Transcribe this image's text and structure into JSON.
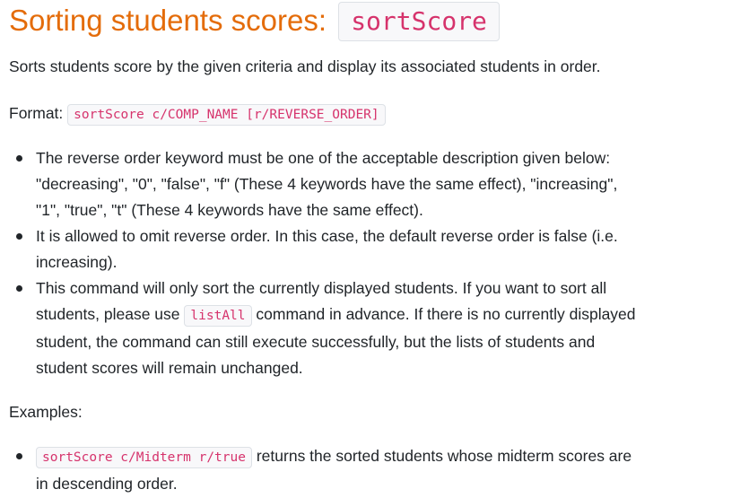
{
  "heading": {
    "text": "Sorting students scores:",
    "code": "sortScore"
  },
  "description": "Sorts students score by the given criteria and display its associated students in order.",
  "format": {
    "label": "Format:",
    "code": "sortScore c/COMP_NAME [r/REVERSE_ORDER]"
  },
  "notes": [
    {
      "lines": [
        "The reverse order keyword must be one of the acceptable description given below:",
        "\"decreasing\", \"0\", \"false\", \"f\" (These 4 keywords have the same effect), \"increasing\",",
        "\"1\", \"true\", \"t\" (These 4 keywords have the same effect)."
      ]
    },
    {
      "lines": [
        "It is allowed to omit reverse order. In this case, the default reverse order is false (i.e.",
        "increasing)."
      ]
    },
    {
      "line1": "This command will only sort the currently displayed students. If you want to sort all",
      "line2_before": "students, please use",
      "line2_code": "listAll",
      "line2_after": "command in advance. If there is no currently displayed",
      "line3": "student, the command can still execute successfully, but the lists of students and",
      "line4": "student scores will remain unchanged."
    }
  ],
  "examples": {
    "label": "Examples:",
    "items": [
      {
        "code": "sortScore c/Midterm r/true",
        "text_after": "returns the sorted students whose midterm scores are",
        "line2": "in descending order."
      }
    ]
  },
  "colors": {
    "heading": "#e46c0a",
    "code_text": "#d6336c",
    "code_bg": "#f8f8fa",
    "code_border": "#dde1e6",
    "body_text": "#212529"
  }
}
